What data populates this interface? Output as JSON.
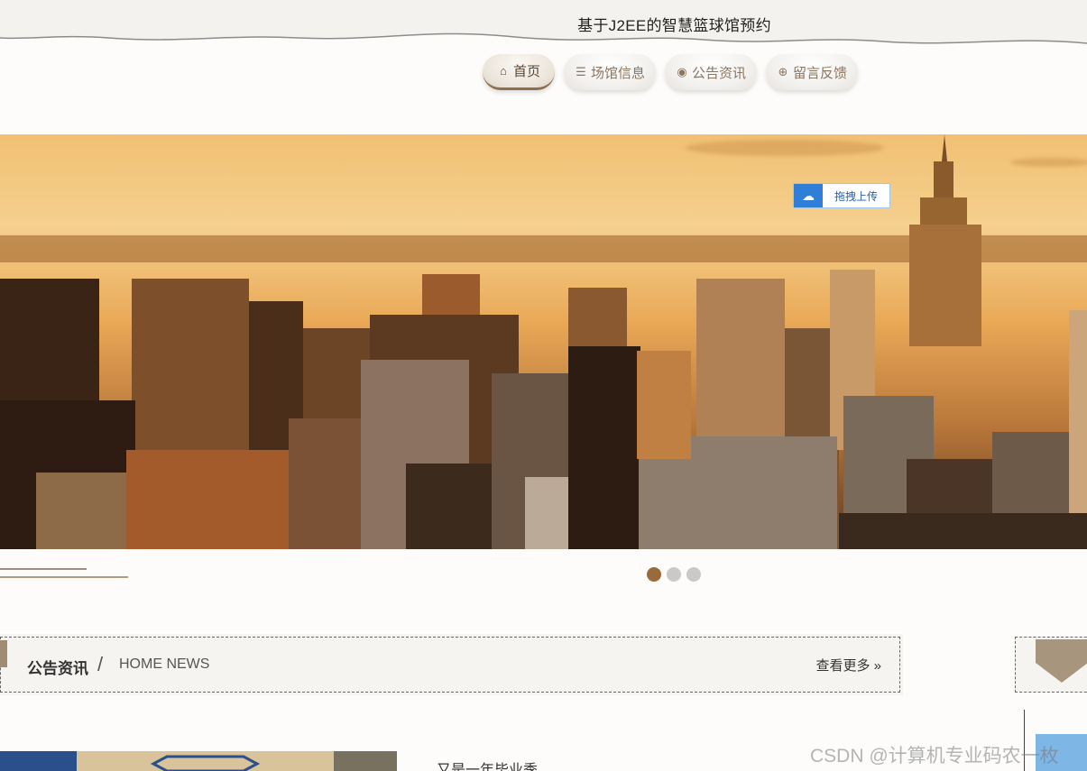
{
  "header": {
    "title": "基于J2EE的智慧篮球馆预约"
  },
  "nav": {
    "items": [
      {
        "label": "首页",
        "icon": "home-icon",
        "active": true
      },
      {
        "label": "场馆信息",
        "icon": "sliders-icon",
        "active": false
      },
      {
        "label": "公告资讯",
        "icon": "palette-icon",
        "active": false
      },
      {
        "label": "留言反馈",
        "icon": "globe-icon",
        "active": false
      }
    ]
  },
  "banner": {
    "upload_label": "拖拽上传",
    "upload_icon": "cloud-upload-icon"
  },
  "slider": {
    "count": 3,
    "active_index": 0
  },
  "section": {
    "title": "公告资讯",
    "separator": "/",
    "subtitle": "HOME NEWS",
    "more_label": "查看更多 »"
  },
  "news": {
    "items": [
      {
        "title": "又是一年毕业季"
      }
    ]
  },
  "watermark": "CSDN @计算机专业码农一枚",
  "colors": {
    "accent": "#9a6a3c",
    "nav_text": "#8a7660",
    "upload_blue": "#2f7ed8"
  }
}
